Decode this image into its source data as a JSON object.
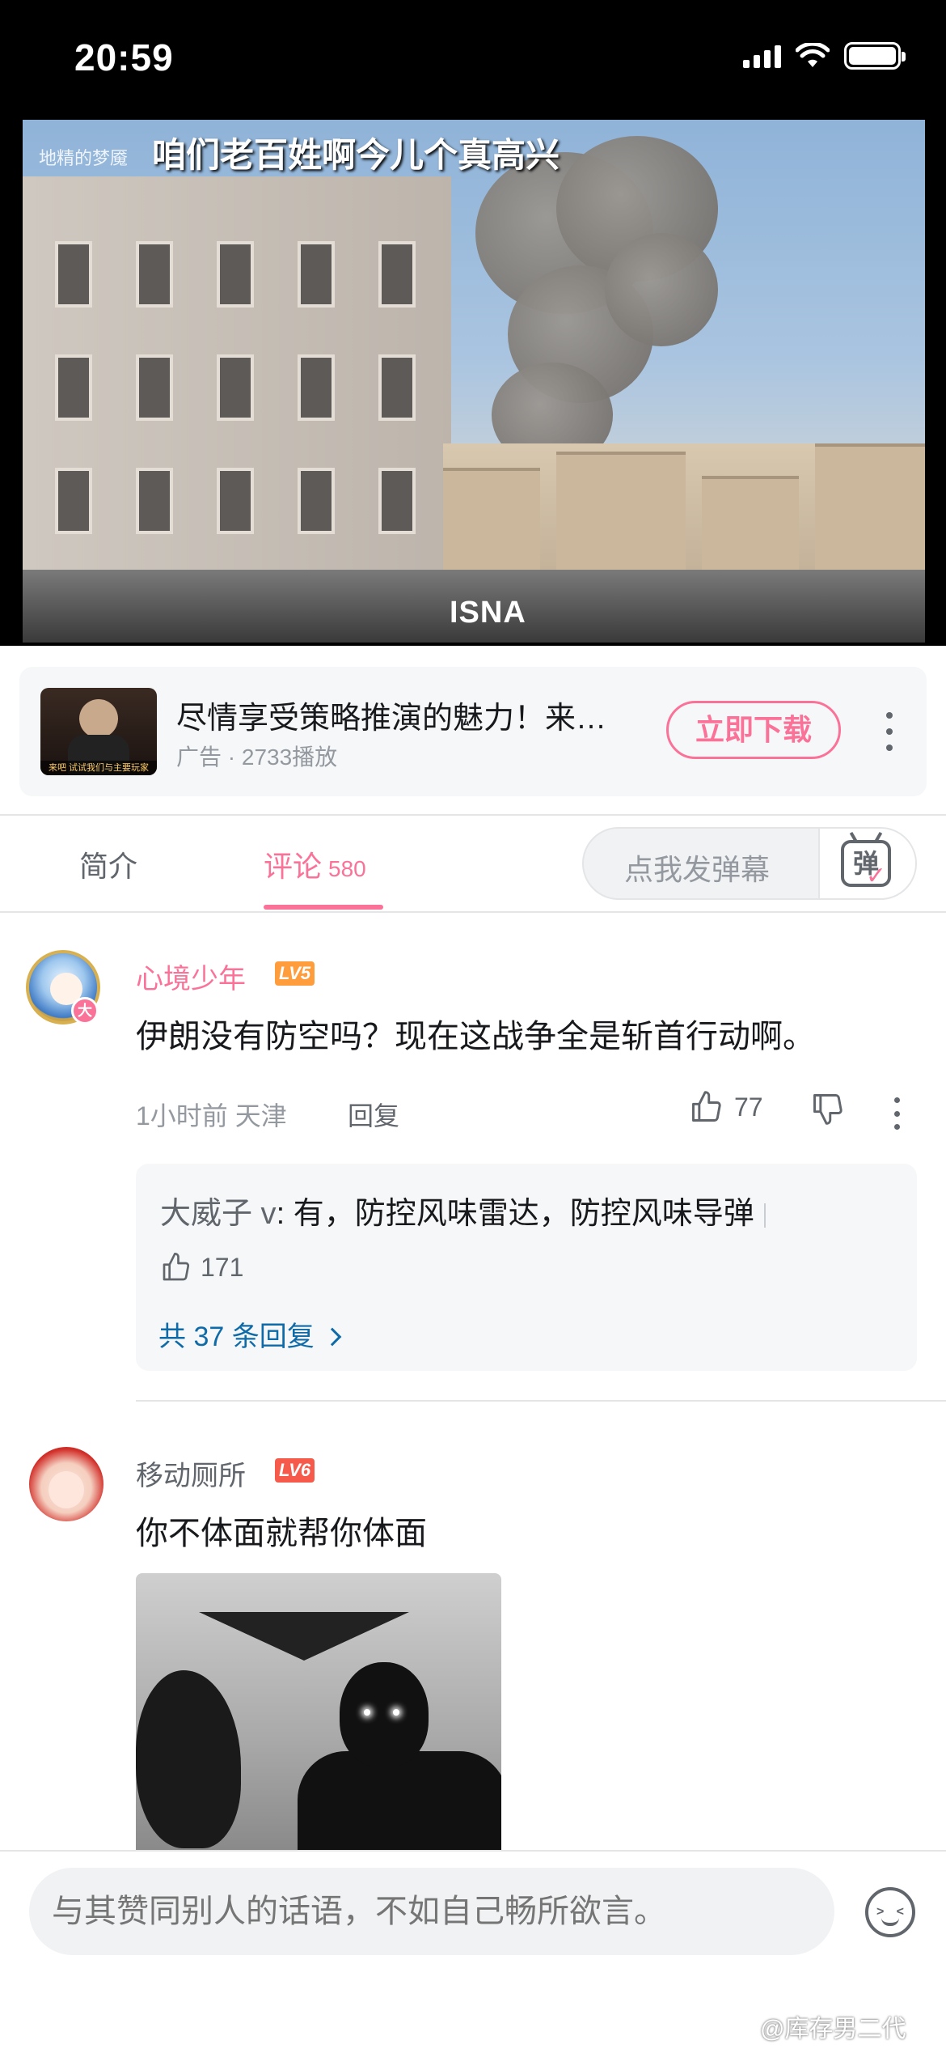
{
  "status_bar": {
    "time": "20:59"
  },
  "video": {
    "caption": "咱们老百姓啊今儿个真高兴",
    "small_watermark": "地精的梦魇",
    "watermark": "ISNA",
    "progress_fraction": 0.78
  },
  "ad": {
    "title": "尽情享受策略推演的魅力！来…",
    "meta": "广告 · 2733播放",
    "download_label": "立即下载",
    "thumb_caption": "来吧 试试我们与主要玩家"
  },
  "tabs": {
    "intro_label": "简介",
    "comments_label": "评论",
    "comments_count": "580",
    "danmaku_placeholder": "点我发弹幕",
    "danmaku_icon_label": "弹"
  },
  "comments": [
    {
      "username": "心境少年",
      "level": "LV5",
      "avatar_badge": "大",
      "text": "伊朗没有防空吗？现在这战争全是斩首行动啊。",
      "meta": "1小时前 天津",
      "reply_label": "回复",
      "likes": "77",
      "subreply": {
        "user": "大威子 v",
        "sep": ": ",
        "text": "有，防控风味雷达，防控风味导弹",
        "likes": "171",
        "total_label": "共 37 条回复"
      }
    },
    {
      "username": "移动厕所",
      "level": "LV6",
      "text": "你不体面就帮你体面"
    }
  ],
  "input": {
    "placeholder": "与其赞同别人的话语，不如自己畅所欲言。"
  },
  "watermark": "@库存男二代",
  "colors": {
    "accent": "#fb7299",
    "link": "#0f6aa8",
    "lv5": "#ff9d3c",
    "lv6": "#f55a4a"
  }
}
